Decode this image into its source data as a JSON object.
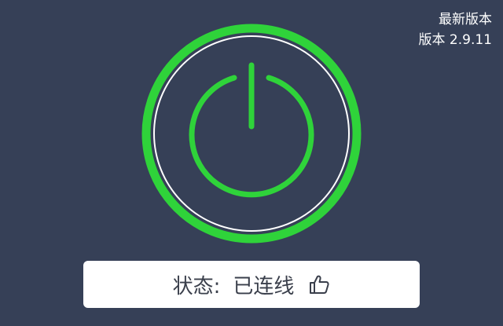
{
  "version": {
    "heading": "最新版本",
    "number": "版本 2.9.11"
  },
  "power": {
    "state": "on",
    "accent_color": "#2fd33a",
    "inner_ring_color": "#ffffff"
  },
  "status": {
    "label": "状态:",
    "value": "已连线",
    "icon": "thumbs-up-icon"
  },
  "colors": {
    "background": "#364057",
    "card": "#ffffff",
    "text": "#3a3f4b"
  }
}
